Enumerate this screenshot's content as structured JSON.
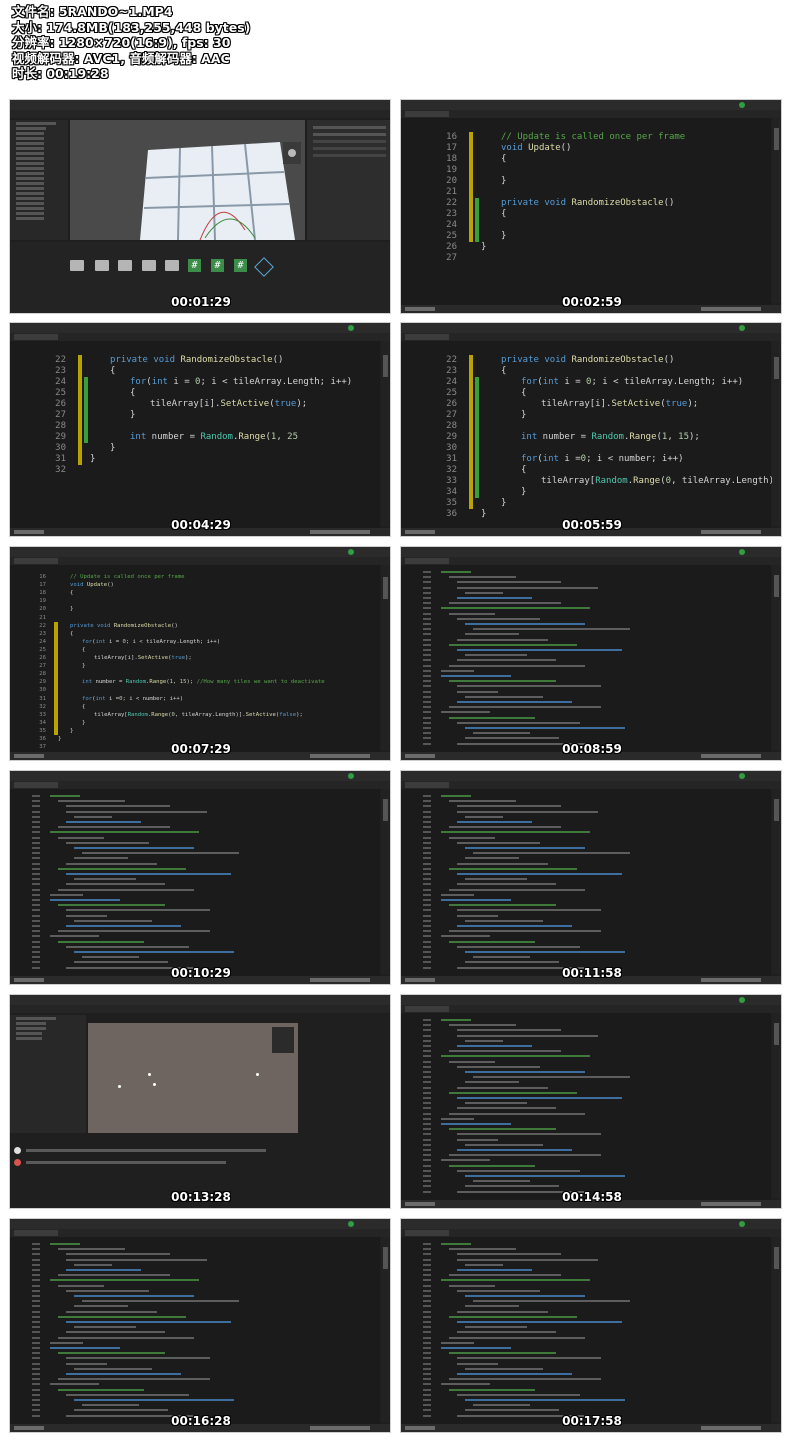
{
  "header": {
    "filename": "文件名: 5RANDO~1.MP4",
    "size": "大小: 174.8MB(183,255,448 bytes)",
    "resolution": "分辨率: 1280×720(16:9), fps: 30",
    "codec": "视频解码器: AVC1, 音频解码器: AAC",
    "duration": "时长: 00:19:28"
  },
  "thumbnails": [
    {
      "timestamp": "00:01:29",
      "kind": "unity-editor"
    },
    {
      "timestamp": "00:02:59",
      "kind": "code-large"
    },
    {
      "timestamp": "00:04:29",
      "kind": "code-large"
    },
    {
      "timestamp": "00:05:59",
      "kind": "code-large"
    },
    {
      "timestamp": "00:07:29",
      "kind": "code-medium"
    },
    {
      "timestamp": "00:08:59",
      "kind": "code-small"
    },
    {
      "timestamp": "00:10:29",
      "kind": "code-small"
    },
    {
      "timestamp": "00:11:58",
      "kind": "code-small"
    },
    {
      "timestamp": "00:13:28",
      "kind": "unity-game"
    },
    {
      "timestamp": "00:14:58",
      "kind": "code-small"
    },
    {
      "timestamp": "00:16:28",
      "kind": "code-small"
    },
    {
      "timestamp": "00:17:58",
      "kind": "code-small"
    }
  ],
  "code_t2": {
    "lines": [
      "16",
      "17",
      "18",
      "19",
      "20",
      "21",
      "22",
      "23",
      "24",
      "25",
      "26",
      "27"
    ],
    "text": [
      "// Update is called once per frame",
      "void Update()",
      "{",
      "",
      "}",
      "",
      "private void RandomizeObstacle()",
      "{",
      "",
      "}",
      "}",
      ""
    ]
  },
  "code_t3": {
    "lines": [
      "22",
      "23",
      "24",
      "25",
      "26",
      "27",
      "28",
      "29",
      "30",
      "31",
      "32"
    ],
    "text": [
      "private void RandomizeObstacle()",
      "{",
      "for(int i = 0; i < tileArray.Length; i++)",
      "{",
      "tileArray[i].SetActive(true);",
      "}",
      "",
      "int number = Random.Range(1, 25",
      "}",
      "}",
      ""
    ]
  },
  "code_t4": {
    "lines": [
      "22",
      "23",
      "24",
      "25",
      "26",
      "27",
      "28",
      "29",
      "30",
      "31",
      "32",
      "33",
      "34",
      "35",
      "36"
    ],
    "text": [
      "private void RandomizeObstacle()",
      "{",
      "for(int i = 0; i < tileArray.Length; i++)",
      "{",
      "tileArray[i].SetActive(true);",
      "}",
      "",
      "int number = Random.Range(1, 15);",
      "",
      "for(int i =0; i < number; i++)",
      "{",
      "tileArray[Random.Range(0, tileArray.Length)]",
      "}",
      "}",
      "}"
    ]
  },
  "code_t5": {
    "lines": [
      "16",
      "17",
      "18",
      "19",
      "20",
      "21",
      "22",
      "23",
      "24",
      "25",
      "26",
      "27",
      "28",
      "29",
      "30",
      "31",
      "32",
      "33",
      "34",
      "35",
      "36",
      "37"
    ],
    "text": [
      "// Update is called once per frame",
      "void Update()",
      "{",
      "",
      "}",
      "",
      "private void RandomizeObstacle()",
      "{",
      "for(int i = 0; i < tileArray.Length; i++)",
      "{",
      "tileArray[i].SetActive(true);",
      "}",
      "",
      "int number = Random.Range(1, 15); //How many tiles we want to deactivate",
      "",
      "for(int i =0; i < number; i++)",
      "{",
      "tileArray[Random.Range(0, tileArray.Length)].SetActive(false);",
      "}",
      "}",
      "}",
      ""
    ]
  }
}
